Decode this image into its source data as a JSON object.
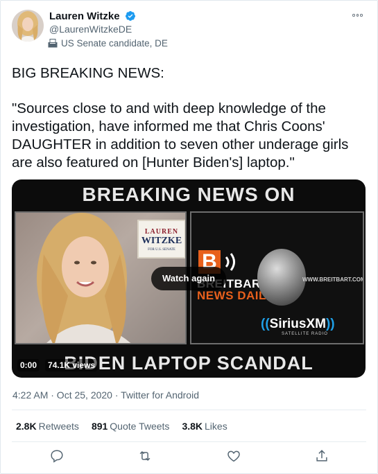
{
  "author": {
    "name": "Lauren Witzke",
    "handle": "@LaurenWitzkeDE",
    "bio_label": "US Senate candidate, DE",
    "verified": true
  },
  "tweet": {
    "line1": "BIG BREAKING NEWS:",
    "line2": "\"Sources close to and with deep knowledge of the investigation, have informed me that Chris Coons' DAUGHTER in addition to seven other underage girls are also featured on [Hunter Biden's] laptop.\""
  },
  "video": {
    "headline_top": "BREAKING NEWS ON",
    "headline_bottom": "BIDEN LAPTOP SCANDAL",
    "sign_line1": "LAUREN",
    "sign_line2": "WITZKE",
    "sign_line3": "FOR U.S. SENATE",
    "breitbart_letter": "B",
    "breitbart_line1": "BREITBART",
    "breitbart_line2": "NEWS DAILY",
    "url_text": "WWW.BREITBART.COM",
    "sirius_text": "SiriusXM",
    "sirius_sub": "SATELLITE RADIO",
    "overlay_button": "Watch again",
    "time": "0:00",
    "views": "74.1K views"
  },
  "meta": {
    "timestamp": "4:22 AM · Oct 25, 2020 · Twitter for Android"
  },
  "stats": {
    "retweets_count": "2.8K",
    "retweets_label": "Retweets",
    "quotes_count": "891",
    "quotes_label": "Quote Tweets",
    "likes_count": "3.8K",
    "likes_label": "Likes"
  },
  "actions": [
    "reply-icon",
    "retweet-icon",
    "like-icon",
    "share-icon"
  ],
  "colors": {
    "verified_blue": "#1d9bf0",
    "secondary_text": "#536471",
    "breitbart_orange": "#e8601c"
  }
}
